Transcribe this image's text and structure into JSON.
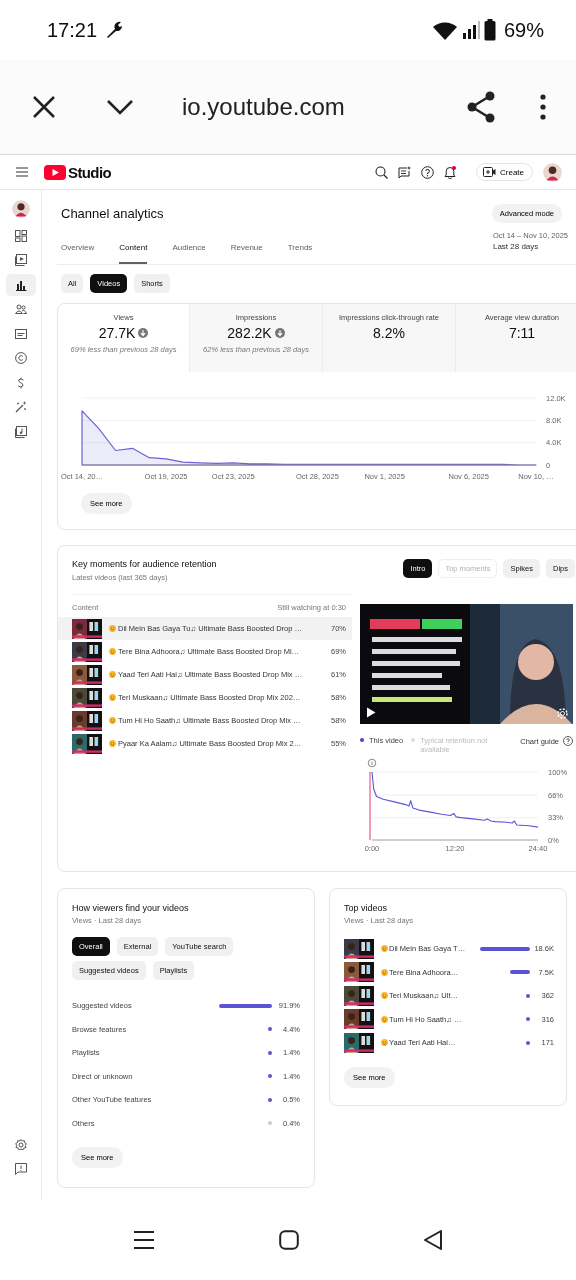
{
  "status_bar": {
    "time": "17:21",
    "battery": "69%"
  },
  "browser": {
    "url": "io.youtube.com"
  },
  "studio_header": {
    "logo_text": "Studio",
    "create_label": "Create",
    "notification_dot": true
  },
  "sidebar": {
    "items": [
      {
        "selected": false
      },
      {
        "selected": false
      },
      {
        "selected": true
      },
      {
        "selected": false
      },
      {
        "selected": false
      },
      {
        "selected": false
      },
      {
        "selected": false
      },
      {
        "selected": false
      },
      {
        "selected": false
      }
    ]
  },
  "page": {
    "title": "Channel analytics",
    "advanced_button": "Advanced mode",
    "tabs": [
      {
        "label": "Overview",
        "selected": false
      },
      {
        "label": "Content",
        "selected": true
      },
      {
        "label": "Audience",
        "selected": false
      },
      {
        "label": "Revenue",
        "selected": false
      },
      {
        "label": "Trends",
        "selected": false
      }
    ],
    "date_range": {
      "dates": "Oct 14 – Nov 10, 2025",
      "label": "Last 28 days"
    },
    "filters": [
      {
        "label": "All",
        "selected": false
      },
      {
        "label": "Videos",
        "selected": true
      },
      {
        "label": "Shorts",
        "selected": false
      }
    ]
  },
  "metrics_card": {
    "metrics": [
      {
        "label": "Views",
        "value": "27.7K",
        "trend_down": true,
        "note": "69% less than previous 28 days",
        "selected": true
      },
      {
        "label": "Impressions",
        "value": "282.2K",
        "trend_down": true,
        "note": "62% less than previous 28 days",
        "selected": false
      },
      {
        "label": "Impressions click-through rate",
        "value": "8.2%",
        "trend_down": false,
        "selected": false
      },
      {
        "label": "Average view duration",
        "value": "7:11",
        "trend_down": false,
        "selected": false
      }
    ],
    "chart_data": {
      "type": "area",
      "categories": [
        "Oct 14, 20…",
        null,
        null,
        null,
        null,
        "Oct 19, 2025",
        null,
        null,
        null,
        "Oct 23, 2025",
        null,
        null,
        null,
        null,
        "Oct 28, 2025",
        null,
        null,
        null,
        "Nov 1, 2025",
        null,
        null,
        null,
        null,
        "Nov 6, 2025",
        null,
        null,
        null,
        "Nov 10, …"
      ],
      "series": [
        {
          "color": "#6b63d4",
          "values": [
            9700,
            6500,
            2600,
            3000,
            1300,
            1100,
            500,
            400,
            300,
            400,
            200,
            200,
            100,
            100,
            100,
            100,
            100,
            100,
            100,
            100,
            100,
            100,
            100,
            100,
            100,
            100,
            0,
            0
          ]
        }
      ],
      "ylim": [
        0,
        12000
      ],
      "yticks": [
        {
          "value": 0,
          "label": "0"
        },
        {
          "value": 4000,
          "label": "4.0K"
        },
        {
          "value": 8000,
          "label": "8.0K"
        },
        {
          "value": 12000,
          "label": "12.0K"
        }
      ]
    },
    "see_more": "See more"
  },
  "key_moments": {
    "title": "Key moments for audience retention",
    "subtitle": "Latest videos (last 365 days)",
    "chips": [
      {
        "label": "Intro",
        "selected": true,
        "disabled": false
      },
      {
        "label": "Top moments",
        "selected": false,
        "disabled": true
      },
      {
        "label": "Spikes",
        "selected": false,
        "disabled": false
      },
      {
        "label": "Dips",
        "selected": false,
        "disabled": false
      }
    ],
    "columns": [
      "Content",
      "Still watching at 0:30"
    ],
    "rows": [
      {
        "title": "Dil Mein Bas Gaya Tu♫ Ultimate Bass Boosted Drop …",
        "value": "70%",
        "selected": true
      },
      {
        "title": "Tere Bina Adhoora♫ Ultimate Bass Boosted Drop Mi…",
        "value": "69%",
        "selected": false
      },
      {
        "title": "Yaad Teri Aati Hai♫ Ultimate Bass Boosted Drop Mix …",
        "value": "61%",
        "selected": false
      },
      {
        "title": "Teri Muskaan♫ Ultimate Bass Boosted Drop Mix 202…",
        "value": "58%",
        "selected": false
      },
      {
        "title": "Tum Hi Ho Saath♫ Ultimate Bass Boosted Drop Mix …",
        "value": "58%",
        "selected": false
      },
      {
        "title": "Pyaar Ka Aalam♫ Ultimate Bass Boosted Drop Mix 2…",
        "value": "55%",
        "selected": false
      }
    ],
    "video": {
      "kind": "picture"
    },
    "legend": [
      {
        "label": "This video",
        "disabled": false
      },
      {
        "label": "Typical retention not available",
        "disabled": true
      }
    ],
    "chart_guide": "Chart guide",
    "chart_data": {
      "type": "line",
      "x": [
        0,
        15,
        40,
        100,
        200,
        300,
        330,
        345,
        365,
        420,
        520,
        620,
        700,
        730,
        750,
        790,
        900,
        1000,
        1030,
        1060,
        1100,
        1200,
        1250,
        1270,
        1290,
        1400,
        1480
      ],
      "series": [
        {
          "color": "#5b55d6",
          "values": [
            100,
            75,
            64,
            60,
            56,
            52,
            50,
            58,
            47,
            44,
            41,
            38,
            36,
            39,
            34,
            33,
            31,
            29,
            31,
            28,
            27,
            26,
            25,
            28,
            22,
            21,
            19
          ]
        }
      ],
      "xlim": [
        0,
        1480
      ],
      "ylim": [
        0,
        100
      ],
      "xticks": [
        {
          "value": 0,
          "label": "0:00"
        },
        {
          "value": 740,
          "label": "12:20"
        },
        {
          "value": 1480,
          "label": "24:40"
        }
      ],
      "yticks": [
        {
          "value": 0,
          "label": "0%"
        },
        {
          "value": 33,
          "label": "33%"
        },
        {
          "value": 66,
          "label": "66%"
        },
        {
          "value": 100,
          "label": "100%"
        }
      ]
    }
  },
  "traffic": {
    "title": "How viewers find your videos",
    "subtitle": "Views · Last 28 days",
    "chips": [
      {
        "label": "Overall",
        "selected": true
      },
      {
        "label": "External",
        "selected": false
      },
      {
        "label": "YouTube search",
        "selected": false
      },
      {
        "label": "Suggested videos",
        "selected": false
      },
      {
        "label": "Playlists",
        "selected": false
      }
    ],
    "items": [
      {
        "label": "Suggested videos",
        "value": "91.9%",
        "color": "#5b55d6"
      },
      {
        "label": "Browse features",
        "value": "4.4%",
        "color": "#5b55d6"
      },
      {
        "label": "Playlists",
        "value": "1.4%",
        "color": "#5b55d6"
      },
      {
        "label": "Direct or unknown",
        "value": "1.4%",
        "color": "#5b55d6"
      },
      {
        "label": "Other YouTube features",
        "value": "0.5%",
        "color": "#5b55d6"
      },
      {
        "label": "Others",
        "value": "0.4%",
        "color": "#cccccc"
      }
    ],
    "see_more": "See more"
  },
  "top_videos": {
    "title": "Top videos",
    "subtitle": "Views · Last 28 days",
    "items": [
      {
        "title": "Dil Mein Bas Gaya T…",
        "views": "18.6K"
      },
      {
        "title": "Tere Bina Adhoora…",
        "views": "7.5K"
      },
      {
        "title": "Teri Muskaan♫ Ult…",
        "views": "362"
      },
      {
        "title": "Tum Hi Ho Saath♫ …",
        "views": "316"
      },
      {
        "title": "Yaad Teri Aati Hai…",
        "views": "171"
      }
    ],
    "see_more": "See more"
  }
}
